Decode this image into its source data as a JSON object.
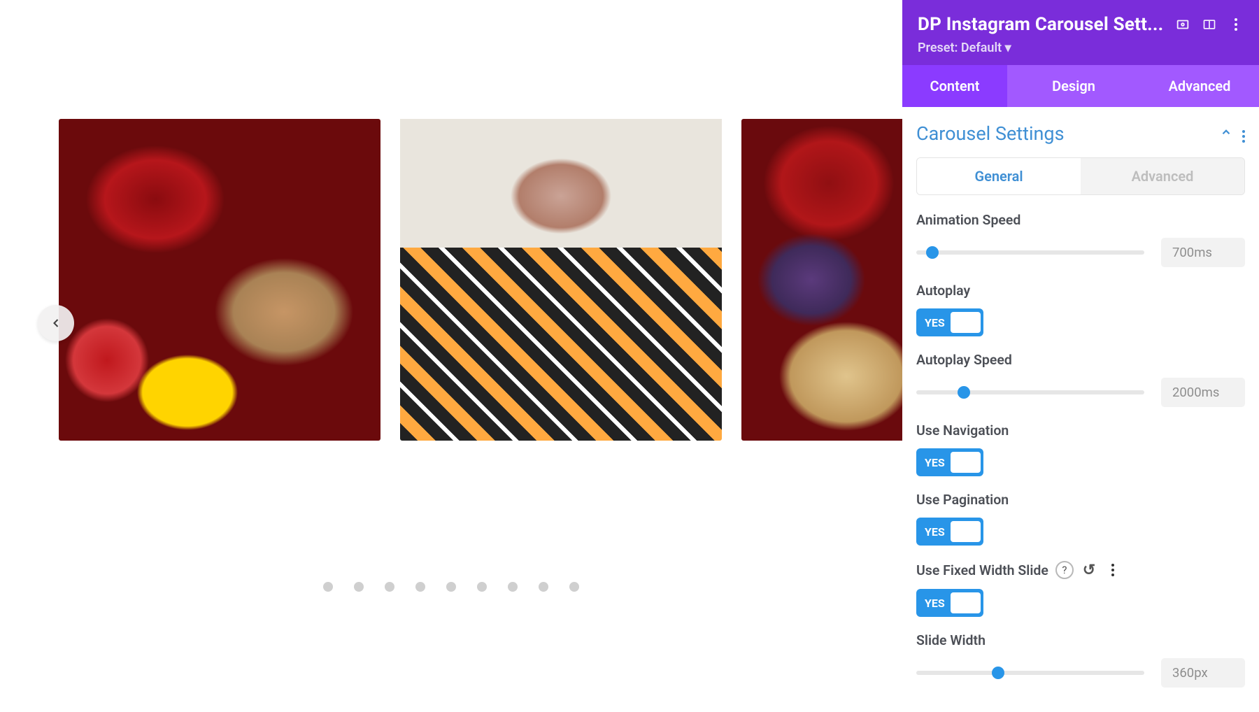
{
  "panel": {
    "title": "DP Instagram Carousel Sett...",
    "preset_label": "Preset:",
    "preset_value": "Default",
    "preset_caret": "▾"
  },
  "tabs": {
    "content": "Content",
    "design": "Design",
    "advanced": "Advanced"
  },
  "section": {
    "title": "Carousel Settings"
  },
  "subtabs": {
    "general": "General",
    "advanced": "Advanced"
  },
  "fields": {
    "animation_speed": {
      "label": "Animation Speed",
      "value": "700ms",
      "pos": 7
    },
    "autoplay": {
      "label": "Autoplay",
      "toggle": "YES"
    },
    "autoplay_speed": {
      "label": "Autoplay Speed",
      "value": "2000ms",
      "pos": 21
    },
    "use_navigation": {
      "label": "Use Navigation",
      "toggle": "YES"
    },
    "use_pagination": {
      "label": "Use Pagination",
      "toggle": "YES"
    },
    "use_fixed_width": {
      "label": "Use Fixed Width Slide",
      "toggle": "YES"
    },
    "slide_width": {
      "label": "Slide Width",
      "value": "360px",
      "pos": 36
    }
  },
  "carousel": {
    "pagination_count": 9
  },
  "icons": {
    "help": "?",
    "reset": "↺"
  }
}
